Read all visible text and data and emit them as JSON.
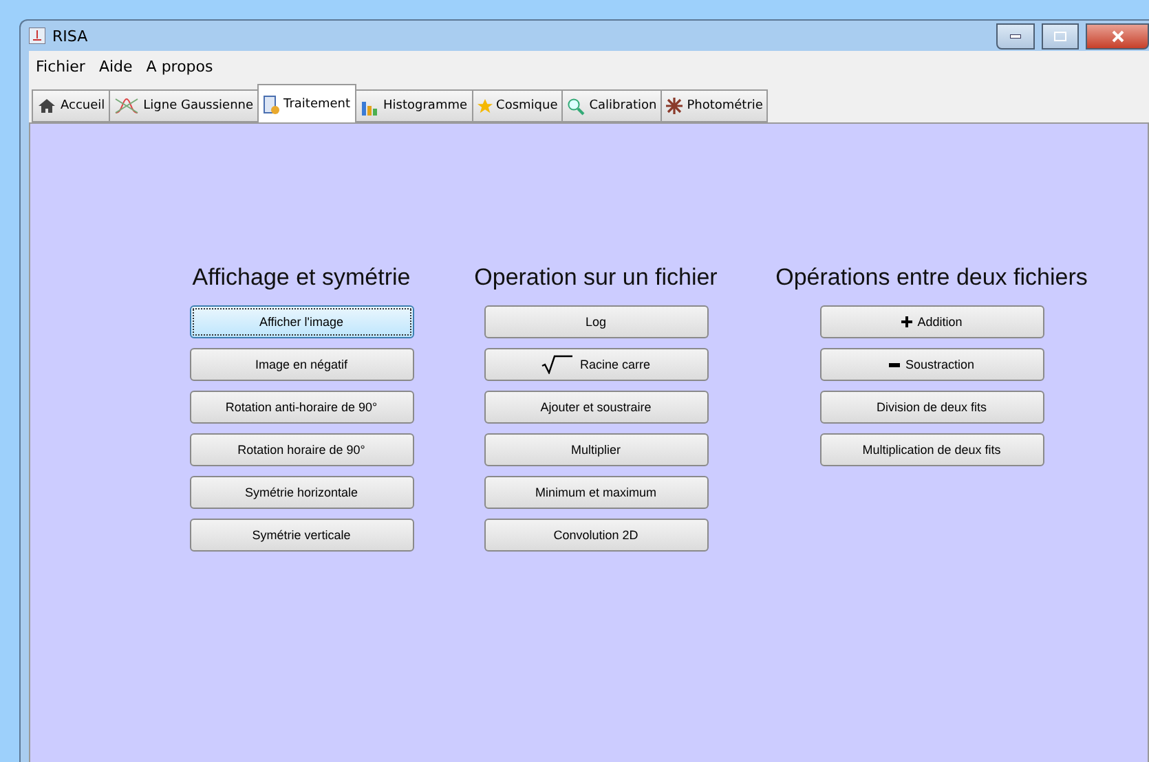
{
  "window": {
    "title": "RISA"
  },
  "menu": [
    "Fichier",
    "Aide",
    "A propos"
  ],
  "tabs": [
    {
      "label": "Accueil",
      "kind": "home",
      "selected": false
    },
    {
      "label": "Ligne Gaussienne",
      "kind": "curve",
      "selected": false
    },
    {
      "label": "Traitement",
      "kind": "calc",
      "selected": true
    },
    {
      "label": "Histogramme",
      "kind": "bars",
      "selected": false
    },
    {
      "label": "Cosmique",
      "kind": "star",
      "selected": false
    },
    {
      "label": "Calibration",
      "kind": "search",
      "selected": false
    },
    {
      "label": "Photométrie",
      "kind": "burst",
      "selected": false
    }
  ],
  "sections": [
    {
      "title": "Affichage et symétrie",
      "buttons": [
        {
          "label": "Afficher l'image",
          "focused": true
        },
        {
          "label": "Image en négatif",
          "focused": false
        },
        {
          "label": "Rotation anti-horaire de 90°",
          "focused": false
        },
        {
          "label": "Rotation horaire de 90°",
          "focused": false
        },
        {
          "label": "Symétrie horizontale",
          "focused": false
        },
        {
          "label": "Symétrie verticale",
          "focused": false
        }
      ]
    },
    {
      "title": "Operation sur un fichier",
      "buttons": [
        {
          "label": "Log",
          "focused": false
        },
        {
          "label": "Racine carre",
          "kind": "sqrt",
          "focused": false
        },
        {
          "label": "Ajouter et soustraire",
          "focused": false
        },
        {
          "label": "Multiplier",
          "focused": false
        },
        {
          "label": "Minimum et maximum",
          "focused": false
        },
        {
          "label": "Convolution 2D",
          "focused": false
        }
      ]
    },
    {
      "title": "Opérations entre deux fichiers",
      "buttons": [
        {
          "label": "Addition",
          "kind": "plus",
          "focused": false
        },
        {
          "label": "Soustraction",
          "kind": "minus",
          "focused": false
        },
        {
          "label": "Division de deux fits",
          "focused": false
        },
        {
          "label": "Multiplication de deux fits",
          "focused": false
        }
      ]
    }
  ]
}
